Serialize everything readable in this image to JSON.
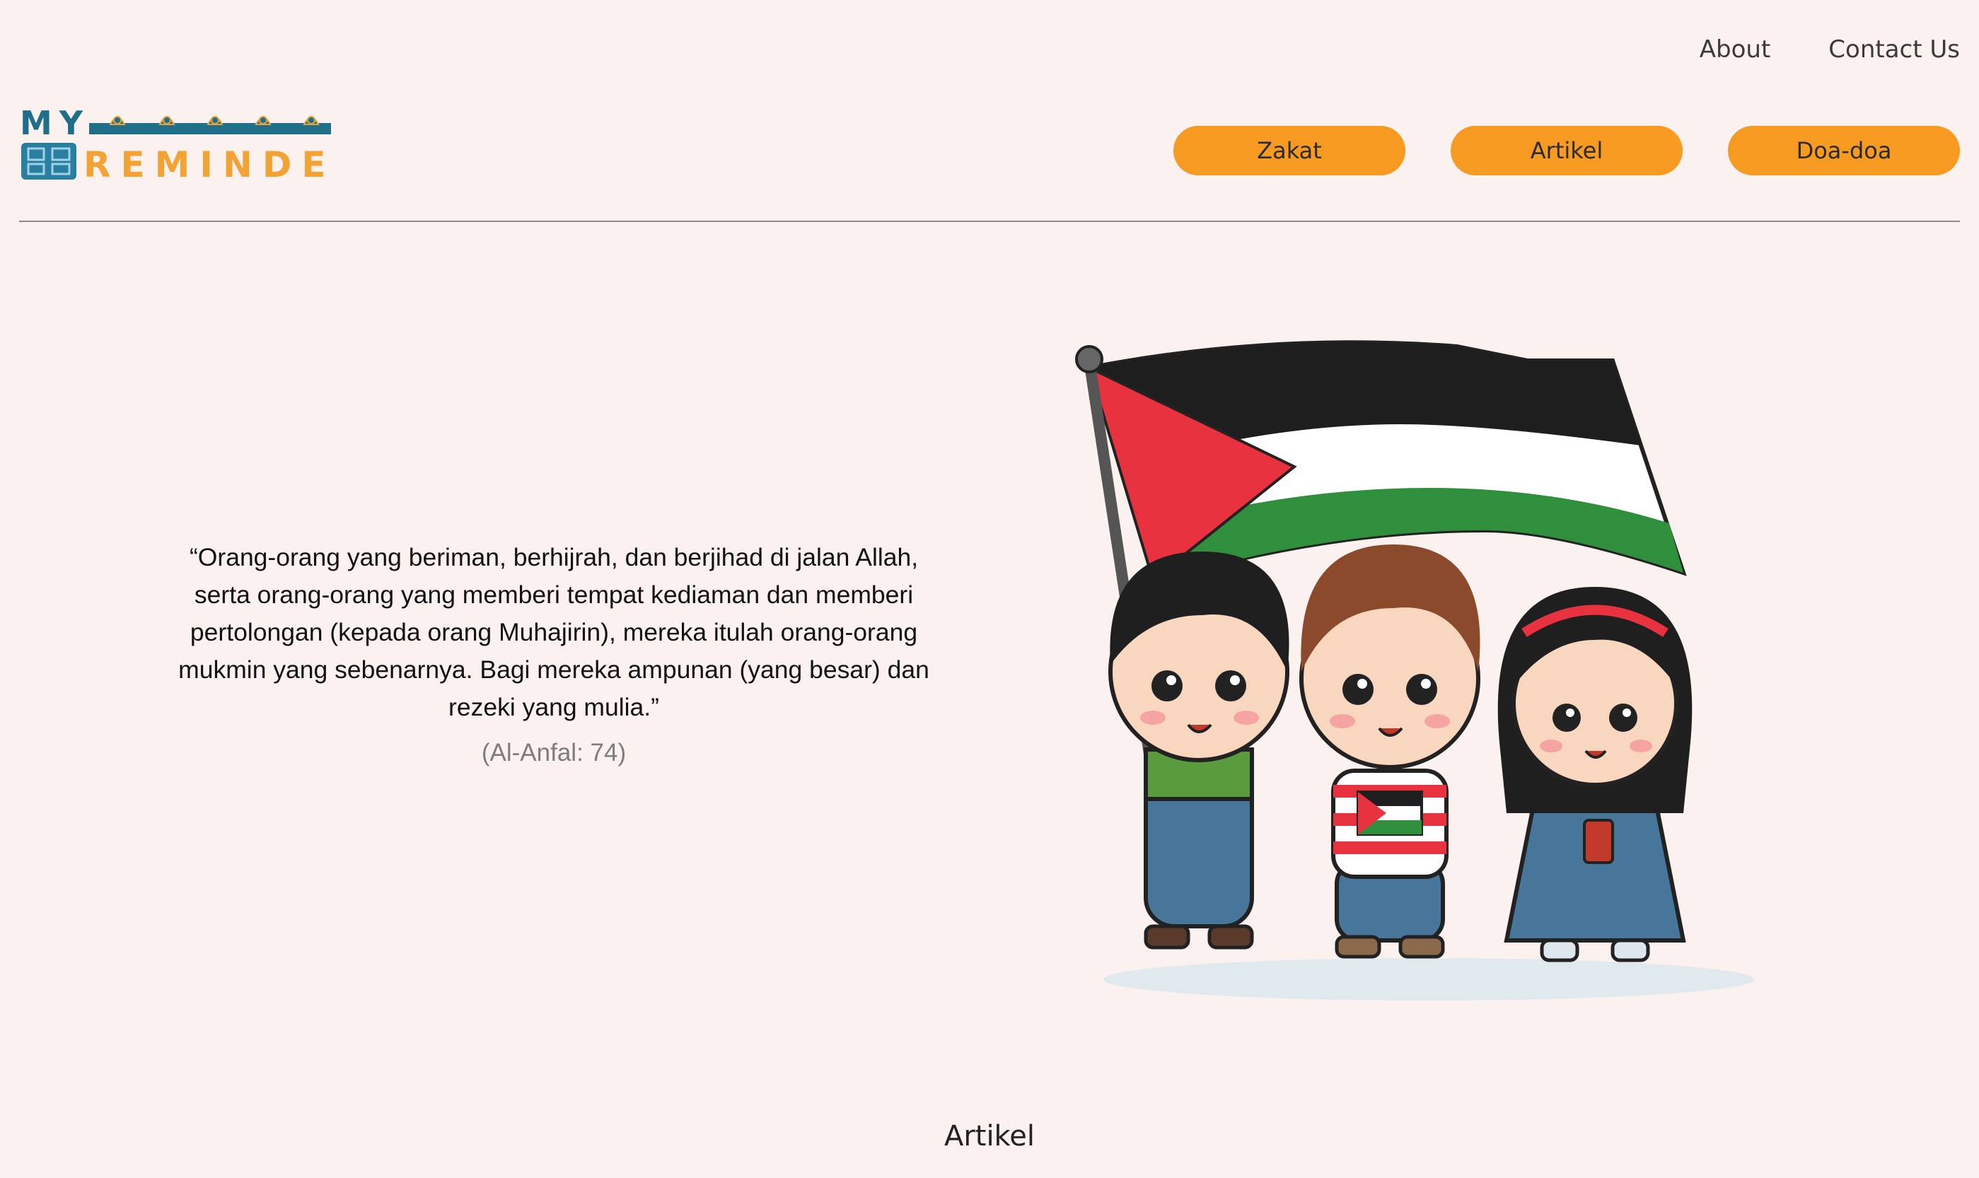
{
  "header": {
    "top_links": [
      "About",
      "Contact Us"
    ],
    "logo": {
      "line1": "MY",
      "line2": "REMINDER"
    },
    "nav": [
      "Zakat",
      "Artikel",
      "Doa-doa"
    ]
  },
  "hero": {
    "quote": "“Orang-orang yang beriman, berhijrah, dan berjihad di jalan Allah, serta orang-orang yang memberi tempat kediaman dan memberi pertolongan (kepada orang Muhajirin), mereka itulah orang-orang mukmin yang sebenarnya. Bagi mereka ampunan (yang besar) dan rezeki yang mulia.”",
    "source": "(Al-Anfal: 74)",
    "image": "children-with-palestine-flag-illustration"
  },
  "sections": {
    "artikel_title": "Artikel"
  },
  "colors": {
    "background": "#fbf2ef",
    "accent": "#f79a21",
    "logo_teal": "#1f6f8b"
  }
}
